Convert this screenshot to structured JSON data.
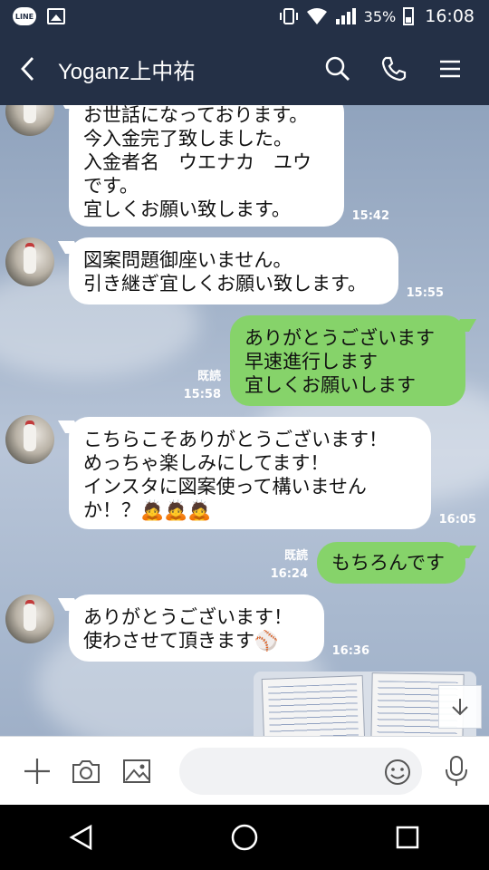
{
  "status_bar": {
    "battery": "35%",
    "time": "16:08",
    "app_badge": "LINE"
  },
  "header": {
    "title": "Yoganz上中祐"
  },
  "messages": [
    {
      "dir": "in",
      "text": "お世話になっております。\n今入金完了致しました。\n入金者名　ウエナカ　ユウ\nです。\n宜しくお願い致します。",
      "time": "15:42",
      "read": ""
    },
    {
      "dir": "in",
      "text": "図案問題御座いません。\n引き継ぎ宜しくお願い致します。",
      "time": "15:55",
      "read": ""
    },
    {
      "dir": "out",
      "text": "ありがとうございます\n早速進行します\n宜しくお願いします",
      "time": "15:58",
      "read": "既読"
    },
    {
      "dir": "in",
      "text": "こちらこそありがとうございます！\nめっちゃ楽しみにしてます！\nインスタに図案使って構いません\nか！？🙇🙇🙇",
      "time": "16:05",
      "read": ""
    },
    {
      "dir": "out",
      "text": "もちろんです",
      "time": "16:24",
      "read": "既読"
    },
    {
      "dir": "in",
      "text": "ありがとうございます！\n使わさせて頂きます⚾",
      "time": "16:36",
      "read": ""
    }
  ],
  "input": {
    "placeholder": ""
  },
  "icons": {
    "back": "chevron-left-icon",
    "search": "search-icon",
    "call": "phone-icon",
    "menu": "menu-icon",
    "add": "plus-icon",
    "camera": "camera-icon",
    "image": "image-icon",
    "emoji": "emoji-icon",
    "mic": "microphone-icon",
    "scroll": "arrow-down-icon"
  },
  "colors": {
    "header": "#243046",
    "incoming_bubble": "#ffffff",
    "outgoing_bubble": "#86d36a"
  }
}
